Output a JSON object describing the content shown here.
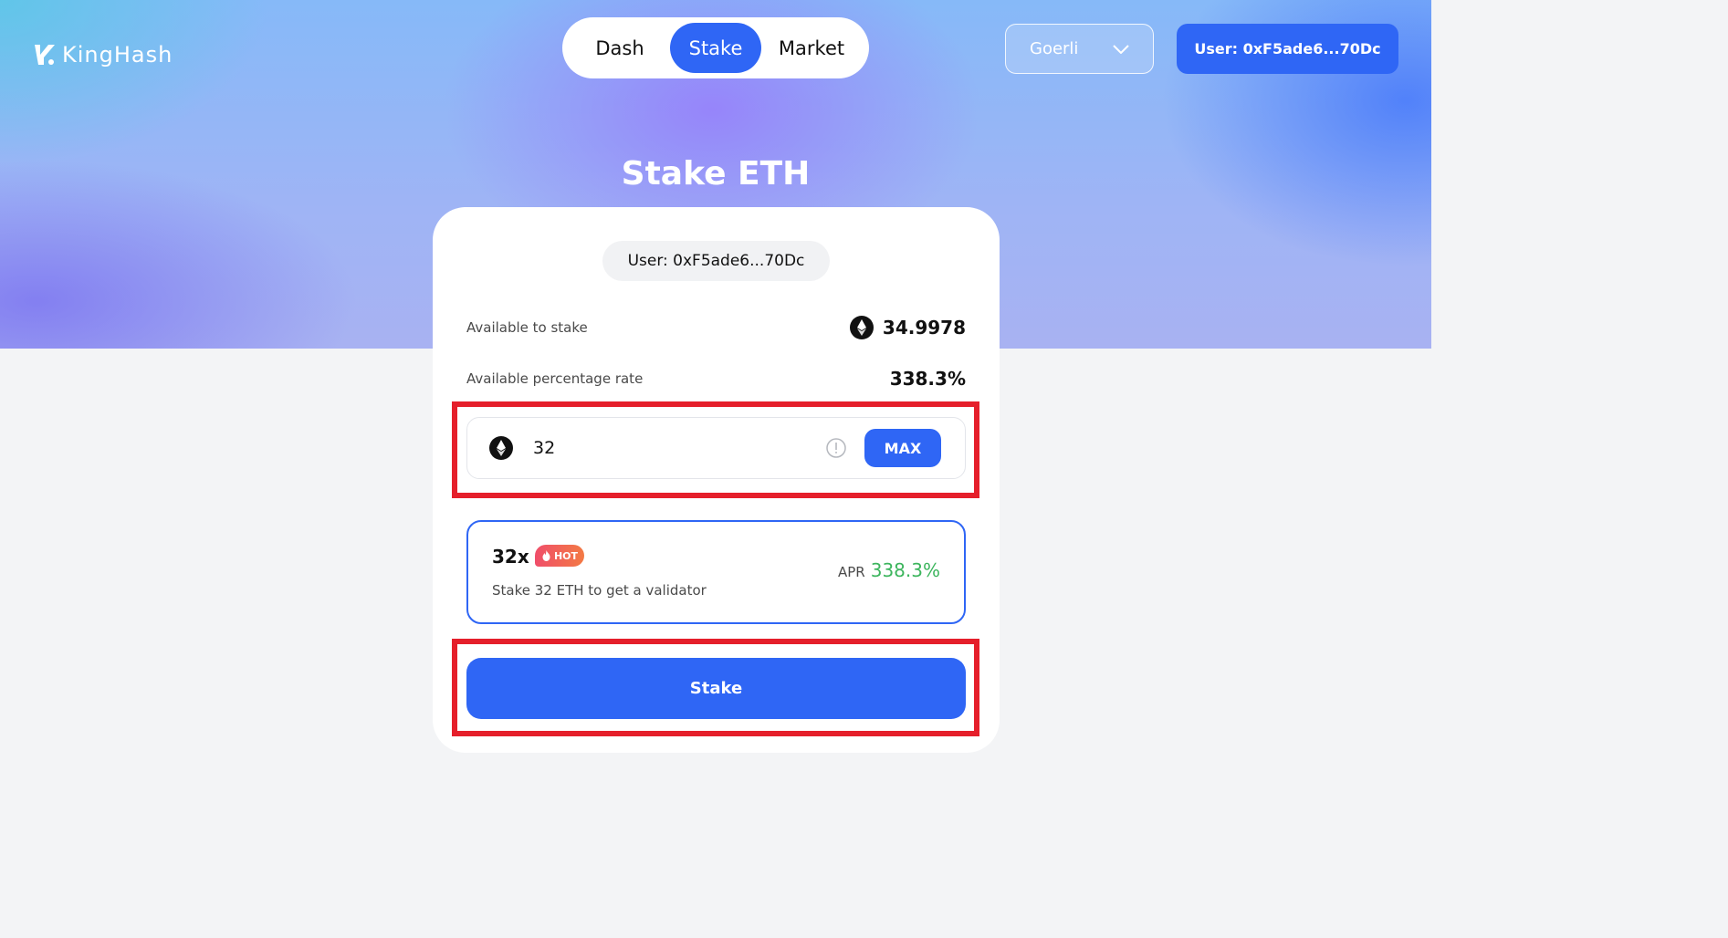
{
  "app": {
    "logo_text": "KingHash"
  },
  "nav": {
    "tabs": [
      {
        "label": "Dash",
        "active": false
      },
      {
        "label": "Stake",
        "active": true
      },
      {
        "label": "Market",
        "active": false
      }
    ]
  },
  "header": {
    "network_label": "Goerli",
    "user_button_label": "User: 0xF5ade6...70Dc"
  },
  "page": {
    "title": "Stake ETH"
  },
  "card": {
    "user_chip": "User: 0xF5ade6...70Dc",
    "available_to_stake_label": "Available to stake",
    "available_to_stake_value": "34.9978",
    "rate_label": "Available percentage rate",
    "rate_value": "338.3%",
    "amount_value": "32",
    "max_label": "MAX",
    "option": {
      "title": "32x",
      "badge": "HOT",
      "description": "Stake 32 ETH to get a validator",
      "apr_label": "APR",
      "apr_value": "338.3%"
    },
    "stake_button_label": "Stake"
  },
  "colors": {
    "accent": "#2f66f5",
    "apr_green": "#3cb55d",
    "highlight_red": "#e51f2b",
    "badge_gradient_start": "#f04e6a",
    "badge_gradient_end": "#f37a44"
  }
}
